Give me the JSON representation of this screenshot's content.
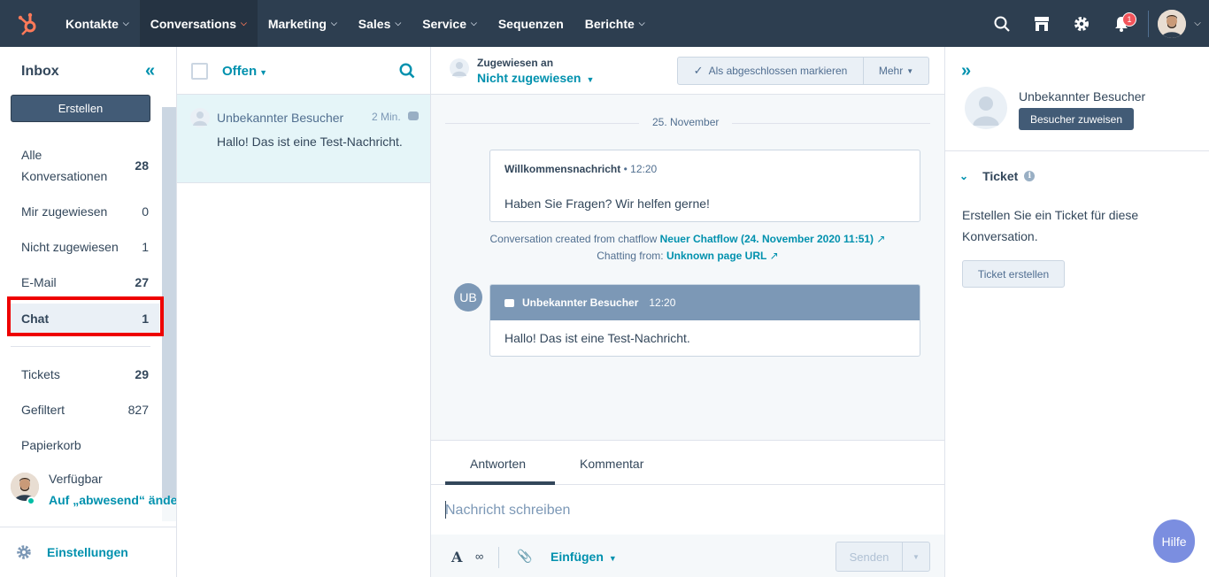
{
  "nav": {
    "items": [
      {
        "label": "Kontakte",
        "chevron": true
      },
      {
        "label": "Conversations",
        "chevron": true
      },
      {
        "label": "Marketing",
        "chevron": true
      },
      {
        "label": "Sales",
        "chevron": true
      },
      {
        "label": "Service",
        "chevron": true
      },
      {
        "label": "Sequenzen",
        "chevron": false
      },
      {
        "label": "Berichte",
        "chevron": true
      }
    ],
    "notification_count": "1",
    "colors": {
      "bar": "#2d3e50",
      "logo": "#ff7a59"
    }
  },
  "inbox": {
    "title": "Inbox",
    "create_label": "Erstellen",
    "menu": [
      {
        "label": "Alle Konversationen",
        "count": "28"
      },
      {
        "label": "Mir zugewiesen",
        "count": "0"
      },
      {
        "label": "Nicht zugewiesen",
        "count": "1"
      },
      {
        "label": "E-Mail",
        "count": "27"
      },
      {
        "label": "Chat",
        "count": "1"
      },
      {
        "label": "Tickets",
        "count": "29"
      },
      {
        "label": "Gefiltert",
        "count": "827"
      },
      {
        "label": "Papierkorb",
        "count": ""
      }
    ],
    "status_label": "Verfügbar",
    "status_link": "Auf „abwesend“ ändern",
    "settings_label": "Einstellungen"
  },
  "list": {
    "filter_label": "Offen",
    "conversation": {
      "name": "Unbekannter Besucher",
      "time": "2 Min.",
      "preview": "Hallo! Das ist eine Test-Nachricht."
    }
  },
  "thread": {
    "assigned_label": "Zugewiesen an",
    "assigned_value": "Nicht zugewiesen",
    "close_label": "Als abgeschlossen markieren",
    "more_label": "Mehr",
    "date": "25. November",
    "welcome": {
      "title": "Willkommensnachricht",
      "time": "12:20",
      "text": "Haben Sie Fragen? Wir helfen gerne!"
    },
    "info": {
      "created_prefix": "Conversation created from chatflow",
      "created_link": "Neuer Chatflow (24. November 2020 11:51)",
      "from_prefix": "Chatting from:",
      "from_link": "Unknown page URL"
    },
    "message": {
      "initials": "UB",
      "sender": "Unbekannter Besucher",
      "time": "12:20",
      "text": "Hallo! Das ist eine Test-Nachricht."
    }
  },
  "composer": {
    "tab_reply": "Antworten",
    "tab_comment": "Kommentar",
    "placeholder": "Nachricht schreiben",
    "insert_label": "Einfügen",
    "send_label": "Senden"
  },
  "contact": {
    "name": "Unbekannter Besucher",
    "assign_label": "Besucher zuweisen",
    "ticket_title": "Ticket",
    "ticket_text": "Erstellen Sie ein Ticket für diese Konversation.",
    "ticket_button": "Ticket erstellen"
  },
  "help_label": "Hilfe"
}
